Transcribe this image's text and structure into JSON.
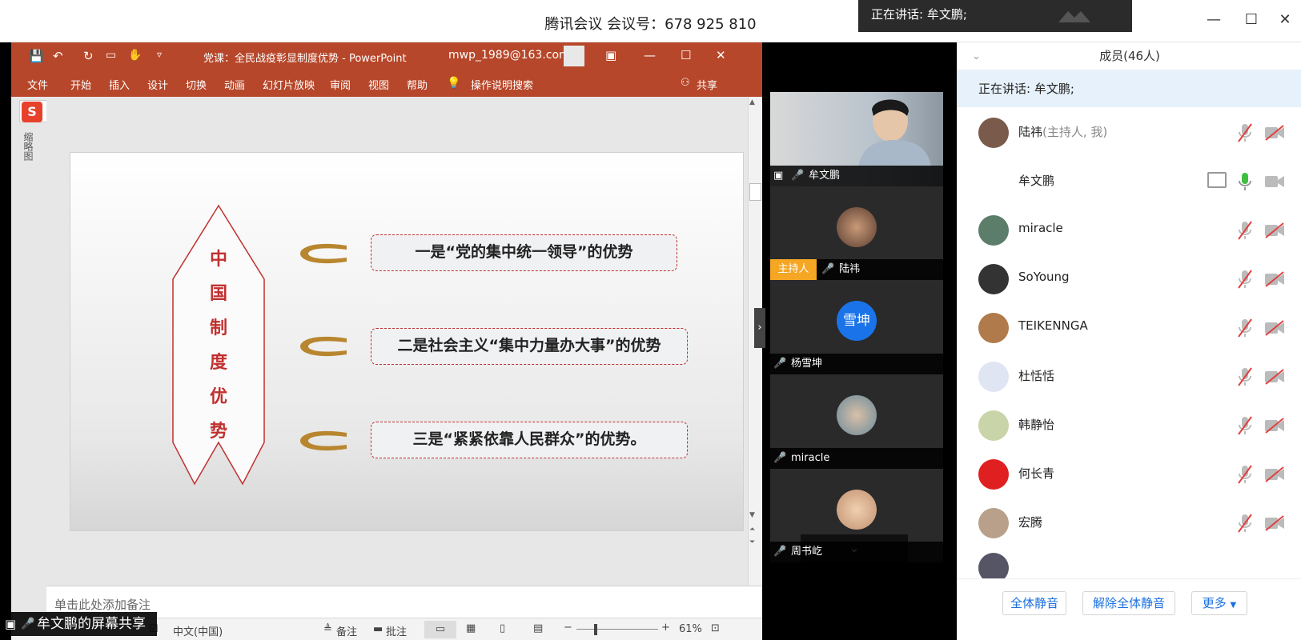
{
  "window": {
    "meeting_title": "腾讯会议 会议号：678 925 810",
    "speaking_toast": "正在讲话: 牟文鹏;"
  },
  "ppt": {
    "doc_title": "党课：全民战疫彰显制度优势 - PowerPoint",
    "account": "mwp_1989@163.com",
    "ribbon_tabs": [
      "文件",
      "开始",
      "插入",
      "设计",
      "切换",
      "动画",
      "幻灯片放映",
      "审阅",
      "视图",
      "帮助"
    ],
    "search_hint": "操作说明搜索",
    "share_label": "共享",
    "thumbnail_label": "缩略图",
    "ime_label": "中",
    "slide": {
      "banner_chars": [
        "中",
        "国",
        "制",
        "度",
        "优",
        "势"
      ],
      "points": [
        "一是“党的集中统一领导”的优势",
        "二是社会主义“集中力量办大事”的优势",
        "三是“紧紧依靠人民群众”的优势。"
      ]
    },
    "notes_placeholder": "单击此处添加备注",
    "status": {
      "language": "中文(中国)",
      "notes": "备注",
      "comments": "批注",
      "zoom": "61%"
    }
  },
  "videos": [
    {
      "name": "牟文鹏",
      "host": "",
      "avatar_text": ""
    },
    {
      "name": "陆祎",
      "host": "主持人",
      "avatar_text": ""
    },
    {
      "name": "杨雪坤",
      "host": "",
      "avatar_text": "雪坤"
    },
    {
      "name": "miracle",
      "host": "",
      "avatar_text": ""
    },
    {
      "name": "周书屹",
      "host": "",
      "avatar_text": ""
    }
  ],
  "members": {
    "title": "成员(46人)",
    "speaking": "正在讲话: 牟文鹏;",
    "list": [
      {
        "name": "陆祎",
        "role": "(主持人, 我)",
        "avatar_color": "#7a5a4a"
      },
      {
        "name": "牟文鹏",
        "role": "",
        "avatar_color": "#ffffff"
      },
      {
        "name": "miracle",
        "role": "",
        "avatar_color": "#5b7d6a"
      },
      {
        "name": "SoYoung",
        "role": "",
        "avatar_color": "#333333"
      },
      {
        "name": "TEIKENNGA",
        "role": "",
        "avatar_color": "#b07a4a"
      },
      {
        "name": "杜恬恬",
        "role": "",
        "avatar_color": "#dfe5f3"
      },
      {
        "name": "韩静怡",
        "role": "",
        "avatar_color": "#c9d4a8"
      },
      {
        "name": "何长青",
        "role": "",
        "avatar_color": "#e02020"
      },
      {
        "name": "宏腾",
        "role": "",
        "avatar_color": "#b8a08a"
      }
    ],
    "footer": {
      "mute_all": "全体静音",
      "unmute_all": "解除全体静音",
      "more": "更多"
    }
  },
  "share_badge": "牟文鹏的屏幕共享"
}
